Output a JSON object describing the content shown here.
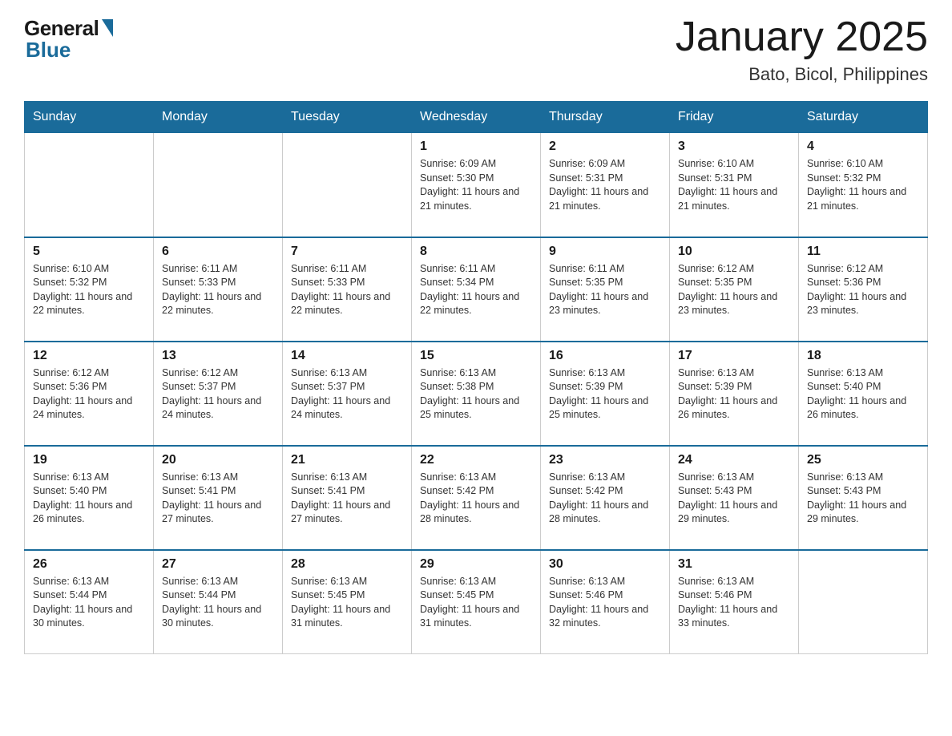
{
  "header": {
    "logo_general": "General",
    "logo_blue": "Blue",
    "title": "January 2025",
    "location": "Bato, Bicol, Philippines"
  },
  "days_of_week": [
    "Sunday",
    "Monday",
    "Tuesday",
    "Wednesday",
    "Thursday",
    "Friday",
    "Saturday"
  ],
  "weeks": [
    [
      {
        "day": "",
        "info": ""
      },
      {
        "day": "",
        "info": ""
      },
      {
        "day": "",
        "info": ""
      },
      {
        "day": "1",
        "info": "Sunrise: 6:09 AM\nSunset: 5:30 PM\nDaylight: 11 hours and 21 minutes."
      },
      {
        "day": "2",
        "info": "Sunrise: 6:09 AM\nSunset: 5:31 PM\nDaylight: 11 hours and 21 minutes."
      },
      {
        "day": "3",
        "info": "Sunrise: 6:10 AM\nSunset: 5:31 PM\nDaylight: 11 hours and 21 minutes."
      },
      {
        "day": "4",
        "info": "Sunrise: 6:10 AM\nSunset: 5:32 PM\nDaylight: 11 hours and 21 minutes."
      }
    ],
    [
      {
        "day": "5",
        "info": "Sunrise: 6:10 AM\nSunset: 5:32 PM\nDaylight: 11 hours and 22 minutes."
      },
      {
        "day": "6",
        "info": "Sunrise: 6:11 AM\nSunset: 5:33 PM\nDaylight: 11 hours and 22 minutes."
      },
      {
        "day": "7",
        "info": "Sunrise: 6:11 AM\nSunset: 5:33 PM\nDaylight: 11 hours and 22 minutes."
      },
      {
        "day": "8",
        "info": "Sunrise: 6:11 AM\nSunset: 5:34 PM\nDaylight: 11 hours and 22 minutes."
      },
      {
        "day": "9",
        "info": "Sunrise: 6:11 AM\nSunset: 5:35 PM\nDaylight: 11 hours and 23 minutes."
      },
      {
        "day": "10",
        "info": "Sunrise: 6:12 AM\nSunset: 5:35 PM\nDaylight: 11 hours and 23 minutes."
      },
      {
        "day": "11",
        "info": "Sunrise: 6:12 AM\nSunset: 5:36 PM\nDaylight: 11 hours and 23 minutes."
      }
    ],
    [
      {
        "day": "12",
        "info": "Sunrise: 6:12 AM\nSunset: 5:36 PM\nDaylight: 11 hours and 24 minutes."
      },
      {
        "day": "13",
        "info": "Sunrise: 6:12 AM\nSunset: 5:37 PM\nDaylight: 11 hours and 24 minutes."
      },
      {
        "day": "14",
        "info": "Sunrise: 6:13 AM\nSunset: 5:37 PM\nDaylight: 11 hours and 24 minutes."
      },
      {
        "day": "15",
        "info": "Sunrise: 6:13 AM\nSunset: 5:38 PM\nDaylight: 11 hours and 25 minutes."
      },
      {
        "day": "16",
        "info": "Sunrise: 6:13 AM\nSunset: 5:39 PM\nDaylight: 11 hours and 25 minutes."
      },
      {
        "day": "17",
        "info": "Sunrise: 6:13 AM\nSunset: 5:39 PM\nDaylight: 11 hours and 26 minutes."
      },
      {
        "day": "18",
        "info": "Sunrise: 6:13 AM\nSunset: 5:40 PM\nDaylight: 11 hours and 26 minutes."
      }
    ],
    [
      {
        "day": "19",
        "info": "Sunrise: 6:13 AM\nSunset: 5:40 PM\nDaylight: 11 hours and 26 minutes."
      },
      {
        "day": "20",
        "info": "Sunrise: 6:13 AM\nSunset: 5:41 PM\nDaylight: 11 hours and 27 minutes."
      },
      {
        "day": "21",
        "info": "Sunrise: 6:13 AM\nSunset: 5:41 PM\nDaylight: 11 hours and 27 minutes."
      },
      {
        "day": "22",
        "info": "Sunrise: 6:13 AM\nSunset: 5:42 PM\nDaylight: 11 hours and 28 minutes."
      },
      {
        "day": "23",
        "info": "Sunrise: 6:13 AM\nSunset: 5:42 PM\nDaylight: 11 hours and 28 minutes."
      },
      {
        "day": "24",
        "info": "Sunrise: 6:13 AM\nSunset: 5:43 PM\nDaylight: 11 hours and 29 minutes."
      },
      {
        "day": "25",
        "info": "Sunrise: 6:13 AM\nSunset: 5:43 PM\nDaylight: 11 hours and 29 minutes."
      }
    ],
    [
      {
        "day": "26",
        "info": "Sunrise: 6:13 AM\nSunset: 5:44 PM\nDaylight: 11 hours and 30 minutes."
      },
      {
        "day": "27",
        "info": "Sunrise: 6:13 AM\nSunset: 5:44 PM\nDaylight: 11 hours and 30 minutes."
      },
      {
        "day": "28",
        "info": "Sunrise: 6:13 AM\nSunset: 5:45 PM\nDaylight: 11 hours and 31 minutes."
      },
      {
        "day": "29",
        "info": "Sunrise: 6:13 AM\nSunset: 5:45 PM\nDaylight: 11 hours and 31 minutes."
      },
      {
        "day": "30",
        "info": "Sunrise: 6:13 AM\nSunset: 5:46 PM\nDaylight: 11 hours and 32 minutes."
      },
      {
        "day": "31",
        "info": "Sunrise: 6:13 AM\nSunset: 5:46 PM\nDaylight: 11 hours and 33 minutes."
      },
      {
        "day": "",
        "info": ""
      }
    ]
  ]
}
